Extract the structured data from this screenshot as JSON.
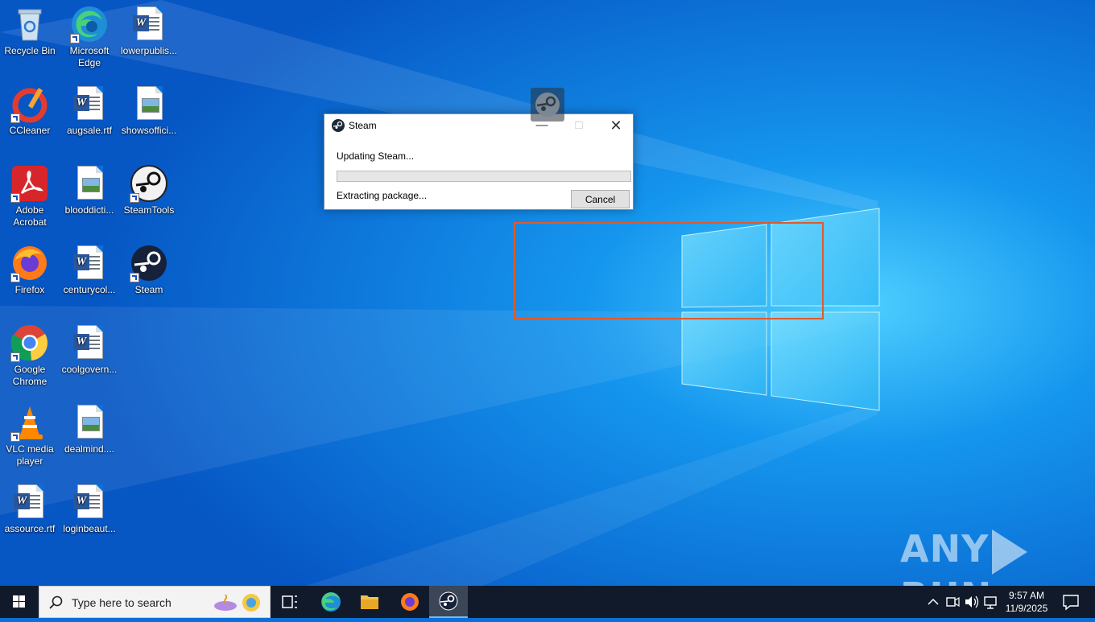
{
  "desktop": {
    "icons": [
      {
        "label": "Recycle Bin",
        "icon": "recycle-bin-icon"
      },
      {
        "label": "Microsoft Edge",
        "icon": "edge-icon"
      },
      {
        "label": "lowerpublis...",
        "icon": "word-doc-icon"
      },
      {
        "label": "CCleaner",
        "icon": "ccleaner-icon"
      },
      {
        "label": "augsale.rtf",
        "icon": "word-doc-icon"
      },
      {
        "label": "showsoffici...",
        "icon": "image-file-icon"
      },
      {
        "label": "Adobe Acrobat",
        "icon": "acrobat-icon"
      },
      {
        "label": "blooddicti...",
        "icon": "image-file-icon"
      },
      {
        "label": "SteamTools",
        "icon": "steam-icon"
      },
      {
        "label": "Firefox",
        "icon": "firefox-icon"
      },
      {
        "label": "centurycol...",
        "icon": "word-doc-icon"
      },
      {
        "label": "Steam",
        "icon": "steam-icon"
      },
      {
        "label": "Google Chrome",
        "icon": "chrome-icon"
      },
      {
        "label": "coolgovern...",
        "icon": "word-doc-icon"
      },
      {
        "label": "VLC media player",
        "icon": "vlc-icon"
      },
      {
        "label": "dealmind....",
        "icon": "image-file-icon"
      },
      {
        "label": "assource.rtf",
        "icon": "word-doc-icon"
      },
      {
        "label": "loginbeaut...",
        "icon": "word-doc-icon"
      }
    ]
  },
  "dialog": {
    "title": "Steam",
    "status_line1": "Updating Steam...",
    "status_line2": "Extracting package...",
    "cancel_label": "Cancel",
    "progress": 0
  },
  "watermark": {
    "left": "ANY",
    "right": "RUN"
  },
  "taskbar": {
    "search_placeholder": "Type here to search",
    "time": "9:57 AM",
    "date": "11/9/2025"
  },
  "colors": {
    "desktop_blue": "#0a6fd8",
    "selection_border": "#e05a2b",
    "taskbar": "#101a2a"
  }
}
